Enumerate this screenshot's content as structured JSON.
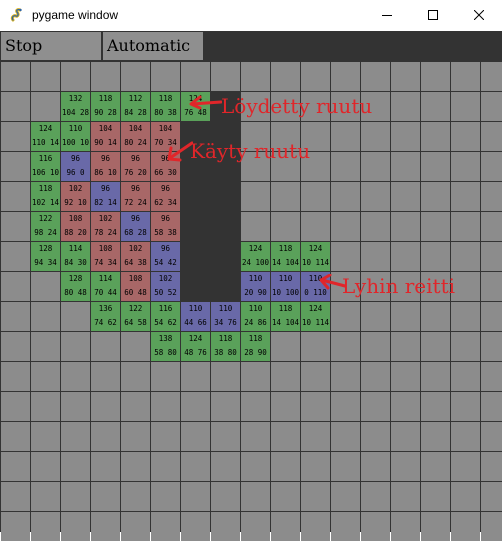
{
  "window": {
    "title": "pygame window"
  },
  "toolbar": {
    "stop_label": "Stop",
    "auto_label": "Automatic"
  },
  "legend": {
    "found": "Löydetty ruutu",
    "visited": "Käyty ruutu",
    "path": "Lyhin reitti"
  },
  "colors": {
    "found": "#5aa15a",
    "visited": "#a86767",
    "path": "#6969a8",
    "wall": "#333333",
    "empty": "#8c8c8c",
    "annotation": "#e0262a"
  },
  "grid": {
    "cols": 17,
    "rows": 16,
    "walls": [
      {
        "row": 1,
        "col": 6
      },
      {
        "row": 1,
        "col": 7
      },
      {
        "row": 2,
        "col": 6
      },
      {
        "row": 2,
        "col": 7
      },
      {
        "row": 3,
        "col": 6
      },
      {
        "row": 3,
        "col": 7
      },
      {
        "row": 4,
        "col": 6
      },
      {
        "row": 4,
        "col": 7
      },
      {
        "row": 5,
        "col": 6
      },
      {
        "row": 5,
        "col": 7
      },
      {
        "row": 6,
        "col": 6
      },
      {
        "row": 6,
        "col": 7
      },
      {
        "row": 7,
        "col": 6
      },
      {
        "row": 7,
        "col": 7
      },
      {
        "row": 8,
        "col": 6
      },
      {
        "row": 8,
        "col": 7
      }
    ],
    "cells": [
      {
        "row": 1,
        "col": 2,
        "state": "found",
        "g": "132",
        "hf": "104 28"
      },
      {
        "row": 1,
        "col": 3,
        "state": "found",
        "g": "118",
        "hf": "90 28"
      },
      {
        "row": 1,
        "col": 4,
        "state": "found",
        "g": "112",
        "hf": "84 28"
      },
      {
        "row": 1,
        "col": 5,
        "state": "found",
        "g": "118",
        "hf": "80 38"
      },
      {
        "row": 1,
        "col": 6,
        "state": "found",
        "g": "124",
        "hf": "76 48"
      },
      {
        "row": 2,
        "col": 1,
        "state": "found",
        "g": "124",
        "hf": "110 14"
      },
      {
        "row": 2,
        "col": 2,
        "state": "found",
        "g": "110",
        "hf": "100 10"
      },
      {
        "row": 2,
        "col": 3,
        "state": "visited",
        "g": "104",
        "hf": "90 14"
      },
      {
        "row": 2,
        "col": 4,
        "state": "visited",
        "g": "104",
        "hf": "80 24"
      },
      {
        "row": 2,
        "col": 5,
        "state": "visited",
        "g": "104",
        "hf": "70 34"
      },
      {
        "row": 3,
        "col": 1,
        "state": "found",
        "g": "116",
        "hf": "106 10"
      },
      {
        "row": 3,
        "col": 2,
        "state": "path",
        "g": "96",
        "hf": "96 0"
      },
      {
        "row": 3,
        "col": 3,
        "state": "visited",
        "g": "96",
        "hf": "86 10"
      },
      {
        "row": 3,
        "col": 4,
        "state": "visited",
        "g": "96",
        "hf": "76 20"
      },
      {
        "row": 3,
        "col": 5,
        "state": "visited",
        "g": "96",
        "hf": "66 30"
      },
      {
        "row": 4,
        "col": 1,
        "state": "found",
        "g": "118",
        "hf": "102 14"
      },
      {
        "row": 4,
        "col": 2,
        "state": "visited",
        "g": "102",
        "hf": "92 10"
      },
      {
        "row": 4,
        "col": 3,
        "state": "path",
        "g": "96",
        "hf": "82 14"
      },
      {
        "row": 4,
        "col": 4,
        "state": "visited",
        "g": "96",
        "hf": "72 24"
      },
      {
        "row": 4,
        "col": 5,
        "state": "visited",
        "g": "96",
        "hf": "62 34"
      },
      {
        "row": 5,
        "col": 1,
        "state": "found",
        "g": "122",
        "hf": "98 24"
      },
      {
        "row": 5,
        "col": 2,
        "state": "visited",
        "g": "108",
        "hf": "88 20"
      },
      {
        "row": 5,
        "col": 3,
        "state": "visited",
        "g": "102",
        "hf": "78 24"
      },
      {
        "row": 5,
        "col": 4,
        "state": "path",
        "g": "96",
        "hf": "68 28"
      },
      {
        "row": 5,
        "col": 5,
        "state": "visited",
        "g": "96",
        "hf": "58 38"
      },
      {
        "row": 6,
        "col": 1,
        "state": "found",
        "g": "128",
        "hf": "94 34"
      },
      {
        "row": 6,
        "col": 2,
        "state": "found",
        "g": "114",
        "hf": "84 30"
      },
      {
        "row": 6,
        "col": 3,
        "state": "visited",
        "g": "108",
        "hf": "74 34"
      },
      {
        "row": 6,
        "col": 4,
        "state": "visited",
        "g": "102",
        "hf": "64 38"
      },
      {
        "row": 6,
        "col": 5,
        "state": "path",
        "g": "96",
        "hf": "54 42"
      },
      {
        "row": 6,
        "col": 8,
        "state": "found",
        "g": "124",
        "hf": "24 100"
      },
      {
        "row": 6,
        "col": 9,
        "state": "found",
        "g": "118",
        "hf": "14 104"
      },
      {
        "row": 6,
        "col": 10,
        "state": "found",
        "g": "124",
        "hf": "10 114"
      },
      {
        "row": 7,
        "col": 2,
        "state": "found",
        "g": "128",
        "hf": "80 48"
      },
      {
        "row": 7,
        "col": 3,
        "state": "found",
        "g": "114",
        "hf": "70 44"
      },
      {
        "row": 7,
        "col": 4,
        "state": "visited",
        "g": "108",
        "hf": "60 48"
      },
      {
        "row": 7,
        "col": 5,
        "state": "path",
        "g": "102",
        "hf": "50 52"
      },
      {
        "row": 7,
        "col": 8,
        "state": "path",
        "g": "110",
        "hf": "20 90"
      },
      {
        "row": 7,
        "col": 9,
        "state": "path",
        "g": "110",
        "hf": "10 100"
      },
      {
        "row": 7,
        "col": 10,
        "state": "path",
        "g": "110",
        "hf": "0 110"
      },
      {
        "row": 8,
        "col": 3,
        "state": "found",
        "g": "136",
        "hf": "74 62"
      },
      {
        "row": 8,
        "col": 4,
        "state": "found",
        "g": "122",
        "hf": "64 58"
      },
      {
        "row": 8,
        "col": 5,
        "state": "found",
        "g": "116",
        "hf": "54 62"
      },
      {
        "row": 8,
        "col": 6,
        "state": "path",
        "g": "110",
        "hf": "44 66"
      },
      {
        "row": 8,
        "col": 7,
        "state": "path",
        "g": "110",
        "hf": "34 76"
      },
      {
        "row": 8,
        "col": 8,
        "state": "found",
        "g": "110",
        "hf": "24 86"
      },
      {
        "row": 8,
        "col": 9,
        "state": "found",
        "g": "118",
        "hf": "14 104"
      },
      {
        "row": 8,
        "col": 10,
        "state": "found",
        "g": "124",
        "hf": "10 114"
      },
      {
        "row": 9,
        "col": 5,
        "state": "found",
        "g": "138",
        "hf": "58 80"
      },
      {
        "row": 9,
        "col": 6,
        "state": "found",
        "g": "124",
        "hf": "48 76"
      },
      {
        "row": 9,
        "col": 7,
        "state": "found",
        "g": "118",
        "hf": "38 80"
      },
      {
        "row": 9,
        "col": 8,
        "state": "found",
        "g": "118",
        "hf": "28 90"
      }
    ]
  }
}
